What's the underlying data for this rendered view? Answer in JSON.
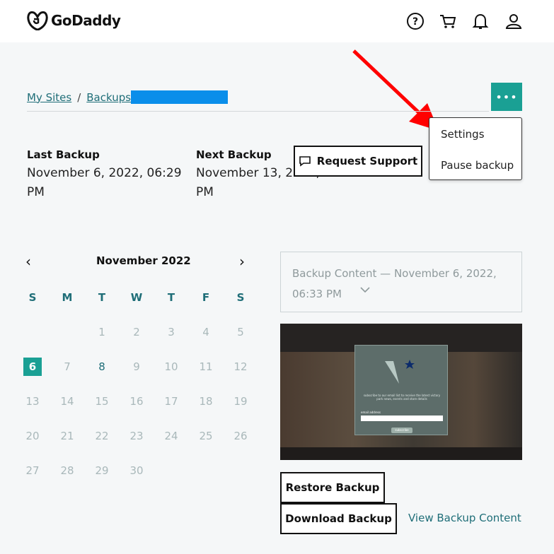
{
  "header": {
    "logo_text": "GoDaddy",
    "icons": [
      "help-icon",
      "cart-icon",
      "bell-icon",
      "user-icon"
    ]
  },
  "breadcrumb": {
    "my_sites": "My Sites",
    "separator": "/",
    "backups": "Backups"
  },
  "menu": {
    "more_label": "•••",
    "settings": "Settings",
    "pause_backup": "Pause backup"
  },
  "backup_info": {
    "last_label": "Last Backup",
    "last_value_line1": "November 6, 2022, 06:29",
    "last_value_line2": "PM",
    "next_label": "Next Backup",
    "next_value_line1": "November 13, 2022, 06:33",
    "next_value_line2": "PM"
  },
  "support": {
    "request_label": "Request Support"
  },
  "calendar": {
    "month_title": "November 2022",
    "prev": "‹",
    "next": "›",
    "weekdays": [
      "S",
      "M",
      "T",
      "W",
      "T",
      "F",
      "S"
    ],
    "weeks": [
      [
        "",
        "",
        "1",
        "2",
        "3",
        "4",
        "5"
      ],
      [
        "6",
        "7",
        "8",
        "9",
        "10",
        "11",
        "12"
      ],
      [
        "13",
        "14",
        "15",
        "16",
        "17",
        "18",
        "19"
      ],
      [
        "20",
        "21",
        "22",
        "23",
        "24",
        "25",
        "26"
      ],
      [
        "27",
        "28",
        "29",
        "30",
        "",
        "",
        ""
      ]
    ],
    "selected_day": "6",
    "available_days": [
      "8"
    ]
  },
  "content": {
    "title": "Backup Content — November 6, 2022, 06:33 PM",
    "modal_text": "subscribe to our email list to receive the latest victory park news, events and store details",
    "modal_field_label": "email address",
    "modal_button": "subscribe"
  },
  "actions": {
    "restore": "Restore Backup",
    "download": "Download Backup",
    "view_content": "View Backup Content"
  },
  "colors": {
    "accent": "#1aa094",
    "link": "#1f6e78",
    "annotation_arrow": "#ff0000",
    "redaction": "#0a8eea"
  }
}
